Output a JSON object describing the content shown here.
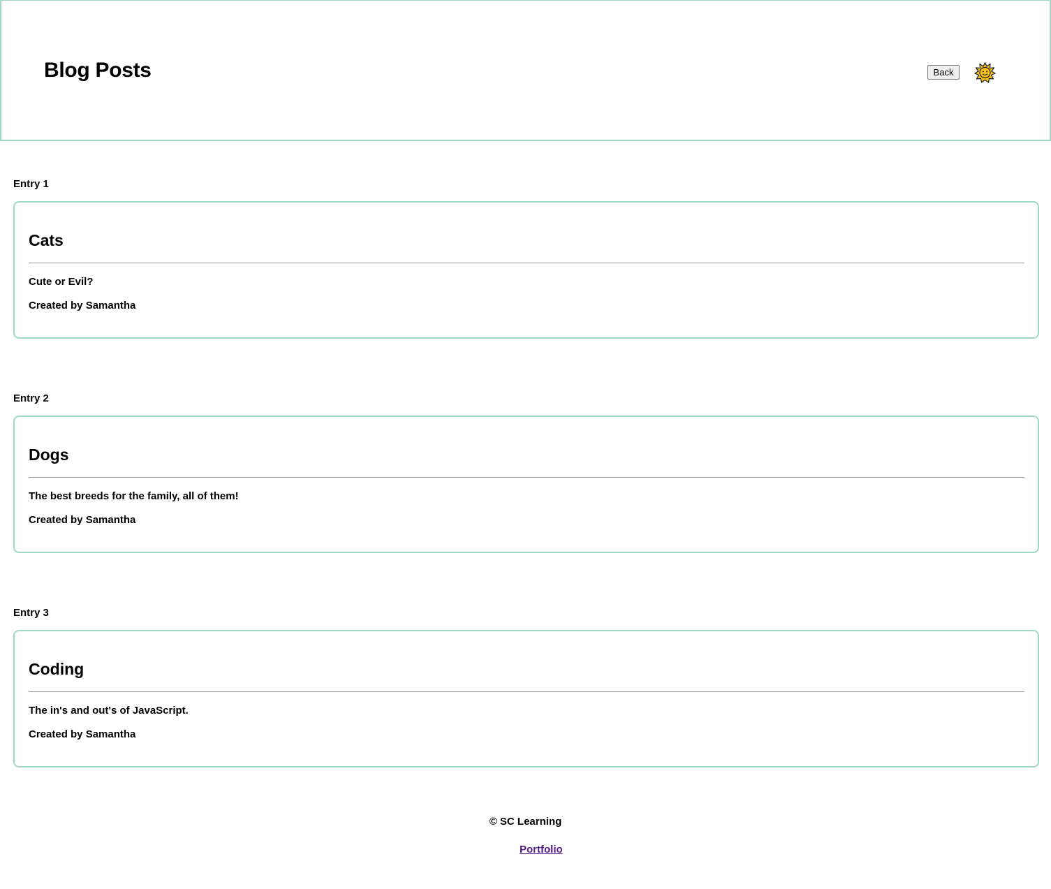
{
  "header": {
    "title": "Blog Posts",
    "back_label": "Back",
    "theme_icon": "sun-icon"
  },
  "entries": [
    {
      "label": "Entry 1",
      "title": "Cats",
      "subtitle": "Cute or Evil?",
      "author_line": "Created by Samantha"
    },
    {
      "label": "Entry 2",
      "title": "Dogs",
      "subtitle": "The best breeds for the family, all of them!",
      "author_line": "Created by Samantha"
    },
    {
      "label": "Entry 3",
      "title": "Coding",
      "subtitle": "The in's and out's of JavaScript.",
      "author_line": "Created by Samantha"
    }
  ],
  "footer": {
    "copyright": "© SC Learning",
    "link_label": "Portfolio"
  },
  "colors": {
    "accent_border": "#9fd9c2",
    "link_visited": "#551a8b",
    "sun_fill": "#f7c21b"
  }
}
